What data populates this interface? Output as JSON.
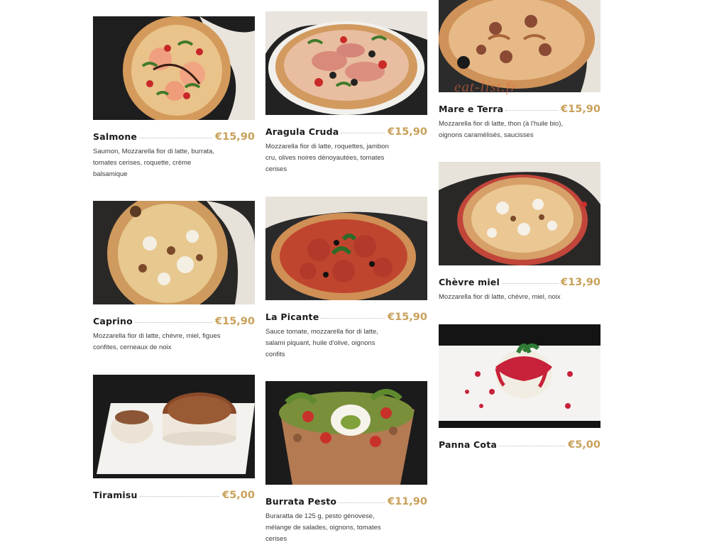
{
  "watermark": "eat-list.fr",
  "colors": {
    "price": "#c8a15a",
    "name": "#1c1c1c",
    "dots": "#b9b9b9"
  },
  "menu": [
    {
      "name": "Salmone",
      "price": "€15,90",
      "desc": "Saumon, Mozzarella fior di latte, burrata, tomates cerises, roquette, crème balsamique"
    },
    {
      "name": "Aragula Cruda",
      "price": "€15,90",
      "desc": "Mozzarella fior di latte, roquettes, jambon cru, olives noires dénoyautées, tomates cerises"
    },
    {
      "name": "Mare e Terra",
      "price": "€15,90",
      "desc": "Mozzarella fior di latte, thon (à l'huile bio), oignons caramélisés, saucisses"
    },
    {
      "name": "Caprino",
      "price": "€15,90",
      "desc": "Mozzarella fior di latte, chèvre, miel, figues confites, cerneaux de noix"
    },
    {
      "name": "La Picante",
      "price": "€15,90",
      "desc": "Sauce tomate, mozzarella fior di latte, salami piquant, huile d'olive, oignons confits"
    },
    {
      "name": "Chèvre miel",
      "price": "€13,90",
      "desc": "Mozzarella fior di latte, chèvre, miel, noix"
    },
    {
      "name": "Tiramisu",
      "price": "€5,00",
      "desc": ""
    },
    {
      "name": "Burrata Pesto",
      "price": "€11,90",
      "desc": "Buraratta de 125 g, pesto génovese, mélange de salades, oignons, tomates cerises"
    },
    {
      "name": "Panna Cota",
      "price": "€5,00",
      "desc": ""
    }
  ]
}
